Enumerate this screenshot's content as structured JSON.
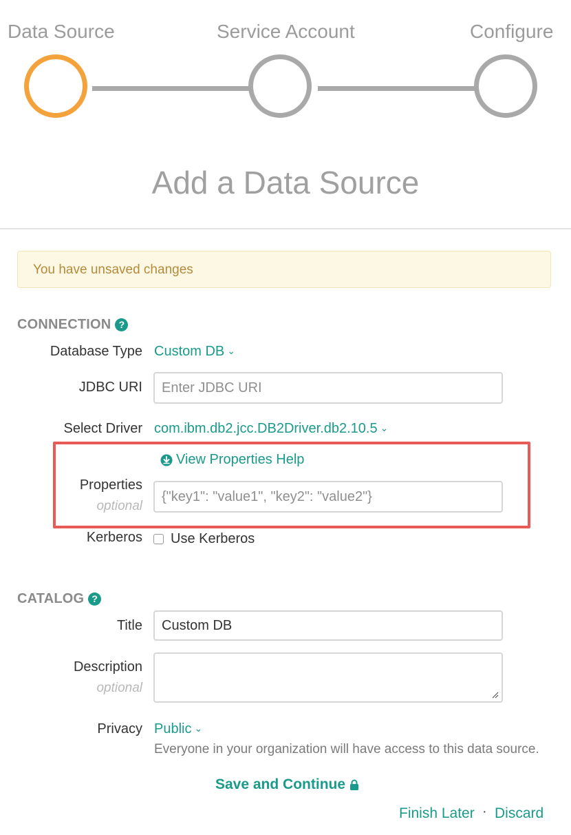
{
  "stepper": {
    "steps": [
      {
        "label": "Data Source",
        "state": "active"
      },
      {
        "label": "Service Account",
        "state": "inactive"
      },
      {
        "label": "Configure",
        "state": "inactive"
      }
    ],
    "colors": {
      "active": "#f4a23c",
      "inactive": "#a9a9a9"
    }
  },
  "page_title": "Add a Data Source",
  "alert": {
    "text": "You have unsaved changes"
  },
  "connection": {
    "heading": "CONNECTION",
    "help_icon": "question-circle-icon",
    "database_type": {
      "label": "Database Type",
      "value": "Custom DB"
    },
    "jdbc_uri": {
      "label": "JDBC URI",
      "value": "",
      "placeholder": "Enter JDBC URI"
    },
    "driver": {
      "label": "Select Driver",
      "value": "com.ibm.db2.jcc.DB2Driver.db2.10.5"
    },
    "properties": {
      "help_link": "View Properties Help",
      "help_link_icon": "download-circle-icon",
      "label": "Properties",
      "optional_label": "optional",
      "value": "",
      "placeholder": "{\"key1\": \"value1\", \"key2\": \"value2\"}"
    },
    "kerberos": {
      "label": "Kerberos",
      "checkbox_label": "Use Kerberos",
      "checked": false
    }
  },
  "catalog": {
    "heading": "CATALOG",
    "help_icon": "question-circle-icon",
    "title": {
      "label": "Title",
      "value": "Custom DB"
    },
    "description": {
      "label": "Description",
      "optional_label": "optional",
      "value": ""
    },
    "privacy": {
      "label": "Privacy",
      "value": "Public",
      "note": "Everyone in your organization will have access to this data source."
    }
  },
  "actions": {
    "save": "Save and Continue",
    "save_icon": "lock-icon",
    "finish_later": "Finish Later",
    "separator": "·",
    "discard": "Discard"
  },
  "colors": {
    "accent": "#1a9a8a",
    "highlight": "#e85a55",
    "alert_bg": "#fcf8e3"
  }
}
